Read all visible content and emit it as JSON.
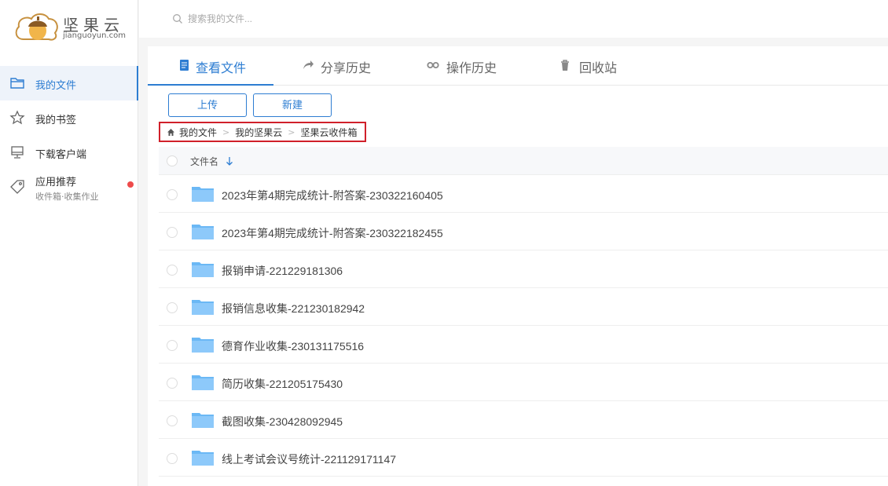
{
  "app": {
    "brand_name": "坚果云",
    "brand_domain": "jianguoyun.com"
  },
  "sidebar": {
    "items": [
      {
        "label": "我的文件",
        "icon": "folder-outline-icon",
        "active": true
      },
      {
        "label": "我的书签",
        "icon": "star-outline-icon"
      },
      {
        "label": "下载客户端",
        "icon": "monitor-icon"
      },
      {
        "label": "应用推荐",
        "sub": "收件箱·收集作业",
        "icon": "tag-icon",
        "has_badge": true
      }
    ]
  },
  "search": {
    "placeholder": "搜索我的文件..."
  },
  "tabs": [
    {
      "label": "查看文件",
      "icon": "file-icon",
      "active": true
    },
    {
      "label": "分享历史",
      "icon": "share-arrow-icon"
    },
    {
      "label": "操作历史",
      "icon": "history-icon"
    },
    {
      "label": "回收站",
      "icon": "trash-icon"
    }
  ],
  "toolbar": {
    "upload_label": "上传",
    "new_label": "新建"
  },
  "breadcrumb": [
    "我的文件",
    "我的坚果云",
    "坚果云收件箱"
  ],
  "list": {
    "header_label": "文件名",
    "rows": [
      "2023年第4期完成统计-附答案-230322160405",
      "2023年第4期完成统计-附答案-230322182455",
      "报销申请-221229181306",
      "报销信息收集-221230182942",
      "德育作业收集-230131175516",
      "简历收集-221205175430",
      "截图收集-230428092945",
      "线上考试会议号统计-221129171147"
    ]
  },
  "colors": {
    "accent": "#2d7dd2",
    "highlight_border": "#d0202a",
    "folder": "#6bb8f5"
  }
}
